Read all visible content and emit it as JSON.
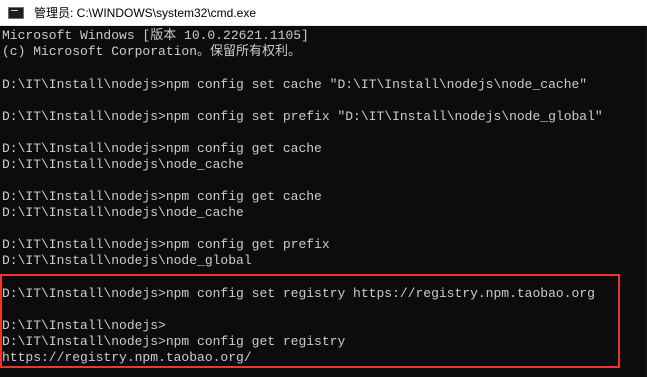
{
  "window": {
    "title": "管理员: C:\\WINDOWS\\system32\\cmd.exe",
    "icon": "cmd-icon"
  },
  "terminal": {
    "lines": [
      "Microsoft Windows [版本 10.0.22621.1105]",
      "(c) Microsoft Corporation。保留所有权利。",
      "",
      "D:\\IT\\Install\\nodejs>npm config set cache \"D:\\IT\\Install\\nodejs\\node_cache\"",
      "",
      "D:\\IT\\Install\\nodejs>npm config set prefix \"D:\\IT\\Install\\nodejs\\node_global\"",
      "",
      "D:\\IT\\Install\\nodejs>npm config get cache",
      "D:\\IT\\Install\\nodejs\\node_cache",
      "",
      "D:\\IT\\Install\\nodejs>npm config get cache",
      "D:\\IT\\Install\\nodejs\\node_cache",
      "",
      "D:\\IT\\Install\\nodejs>npm config get prefix",
      "D:\\IT\\Install\\nodejs\\node_global",
      "",
      "D:\\IT\\Install\\nodejs>npm config set registry https://registry.npm.taobao.org",
      "",
      "D:\\IT\\Install\\nodejs>",
      "D:\\IT\\Install\\nodejs>npm config get registry",
      "https://registry.npm.taobao.org/"
    ]
  },
  "colors": {
    "background": "#0c0c0c",
    "foreground": "#cccccc",
    "highlight": "#e8372e"
  }
}
